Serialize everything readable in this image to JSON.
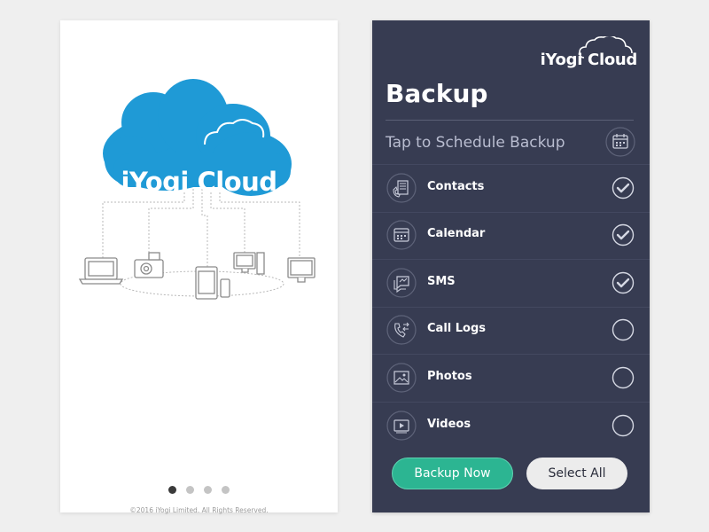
{
  "splash": {
    "logo_text": "iYogi Cloud",
    "pagination": {
      "count": 4,
      "active_index": 0
    },
    "copyright": "©2016 iYogi Limited. All Rights Reserved."
  },
  "backup": {
    "brand_text": "iYogi Cloud",
    "title": "Backup",
    "schedule_label": "Tap to Schedule Backup",
    "items": [
      {
        "label": "Contacts",
        "icon": "contacts-icon",
        "checked": true
      },
      {
        "label": "Calendar",
        "icon": "calendar-icon",
        "checked": true
      },
      {
        "label": "SMS",
        "icon": "sms-icon",
        "checked": true
      },
      {
        "label": "Call Logs",
        "icon": "call-logs-icon",
        "checked": false
      },
      {
        "label": "Photos",
        "icon": "photos-icon",
        "checked": false
      },
      {
        "label": "Videos",
        "icon": "videos-icon",
        "checked": false
      }
    ],
    "backup_now_label": "Backup Now",
    "select_all_label": "Select All"
  },
  "colors": {
    "cloud_blue": "#1f9ad6",
    "panel_navy": "#373c52",
    "accent_green": "#2cb592",
    "outline_gray": "#b5b5b5"
  }
}
